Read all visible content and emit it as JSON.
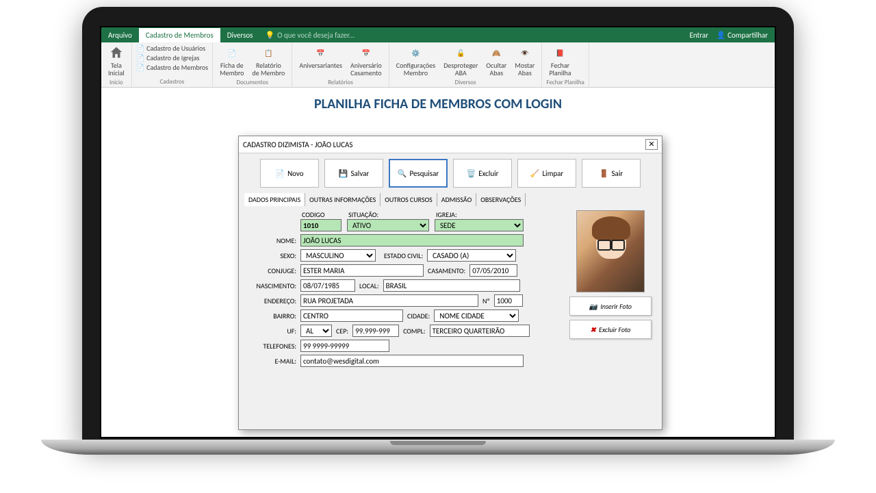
{
  "tabs": {
    "arquivo": "Arquivo",
    "cadastro": "Cadastro de Membros",
    "diversos": "Diversos",
    "search": "O que você deseja fazer...",
    "entrar": "Entrar",
    "compartilhar": "Compartilhar"
  },
  "ribbon": {
    "inicio": {
      "tela": "Tela\nInicial",
      "label": "Início"
    },
    "cadastros": {
      "usuarios": "Cadastro de Usuários",
      "igrejas": "Cadastro de Igrejas",
      "membros": "Cadastro de Membros",
      "label": "Cadastros"
    },
    "documentos": {
      "ficha": "Ficha de\nMembro",
      "relatorio": "Relatório\nde Membro",
      "label": "Documentos"
    },
    "relatorios": {
      "aniv": "Aniversariantes",
      "casamento": "Aniversário\nCasamento",
      "label": "Relatórios"
    },
    "diversos": {
      "config": "Configurações\nMembro",
      "desproteger": "Desproteger\nABA",
      "ocultar": "Ocultar\nAbas",
      "mostrar": "Mostar\nAbas",
      "label": "Diversos"
    },
    "fechar": {
      "fecharp": "Fechar\nPlanilha",
      "label": "Fechar Planilha"
    }
  },
  "page_title": "PLANILHA FICHA DE MEMBROS COM LOGIN",
  "dialog": {
    "title": "CADASTRO DIZIMISTA - JOÃO LUCAS",
    "buttons": {
      "novo": "Novo",
      "salvar": "Salvar",
      "pesquisar": "Pesquisar",
      "excluir": "Excluir",
      "limpar": "Limpar",
      "sair": "Sair"
    },
    "tabs": [
      "DADOS PRINCIPAIS",
      "OUTRAS INFORMAÇÕES",
      "OUTROS CURSOS",
      "ADMISSÃO",
      "OBSERVAÇÕES"
    ],
    "labels": {
      "codigo": "CODIGO",
      "situacao": "SITUAÇÃO:",
      "igreja": "IGREJA:",
      "nome": "NOME:",
      "sexo": "SEXO:",
      "estado": "ESTADO CIVIL:",
      "conjuge": "CONJUGE:",
      "casamento": "CASAMENTO:",
      "nascimento": "NASCIMENTO:",
      "local": "LOCAL:",
      "endereco": "ENDEREÇO:",
      "num": "Nº",
      "bairro": "BAIRRO:",
      "cidade": "CIDADE:",
      "uf": "UF:",
      "cep": "CEP:",
      "compl": "COMPL:",
      "telefones": "TELEFONES:",
      "email": "E-MAIL:",
      "inserir_foto": "Inserir Foto",
      "excluir_foto": "Excluir Foto"
    },
    "values": {
      "codigo": "1010",
      "situacao": "ATIVO",
      "igreja": "SEDE",
      "nome": "JOÃO LUCAS",
      "sexo": "MASCULINO",
      "estado": "CASADO (A)",
      "conjuge": "ESTER MARIA",
      "casamento": "07/05/2010",
      "nascimento": "08/07/1985",
      "local": "BRASIL",
      "endereco": "RUA PROJETADA",
      "num": "1000",
      "bairro": "CENTRO",
      "cidade": "NOME CIDADE",
      "uf": "AL",
      "cep": "99.999-999",
      "compl": "TERCEIRO QUARTEIRÃO",
      "telefones": "99 9999-99999",
      "email": "contato@wesdigital.com"
    }
  }
}
